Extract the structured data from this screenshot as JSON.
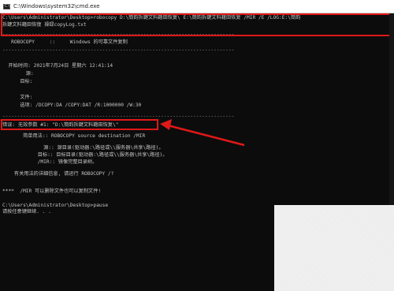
{
  "window": {
    "title": "C:\\Windows\\system32\\cmd.exe"
  },
  "console": {
    "lines": [
      "C:\\Users\\Administrator\\Desktop>robocopy D:\\簡韵拆鍵文料籍田恢复\\ E:\\簡韵拆鍵文料籍田恢复 /MIR /E /LOG:E:\\簡韵",
      "拆鍵文料籍田恢復 操録copyLog.txt",
      "-------------------------------------------------------------------------------",
      "   ROBOCOPY     ::     Windows 的可靠文件复制",
      "-------------------------------------------------------------------------------",
      "  开始时间: 2021年7月24日 星期六 12:41:14",
      "        源:",
      "      目标:",
      "      文件:",
      "      选项: /DCOPY:DA /COPY:DAT /R:1000000 /W:30",
      "-------------------------------------------------------------------------------",
      "错误: 无效参数 #1: \"D:\\簡韵拆鍵文料籍田恢复\\\"",
      "       简单用法:: ROBOCOPY source destination /MIR",
      "              源:: 源目录(驱动器:\\路径或\\\\服务器\\共享\\路径)。",
      "            目标:: 目标目录(驱动器:\\路径或\\\\服务器\\共享\\路径)。",
      "            /MIR:: 镜像完整目录树。",
      "    有关用法的详细信息, 请运行 ROBOCOPY /?",
      "****  /MIR 可以删除文件也可以复制文件!",
      "C:\\Users\\Administrator\\Desktop>pause",
      "请按任意键继续. . ."
    ]
  }
}
